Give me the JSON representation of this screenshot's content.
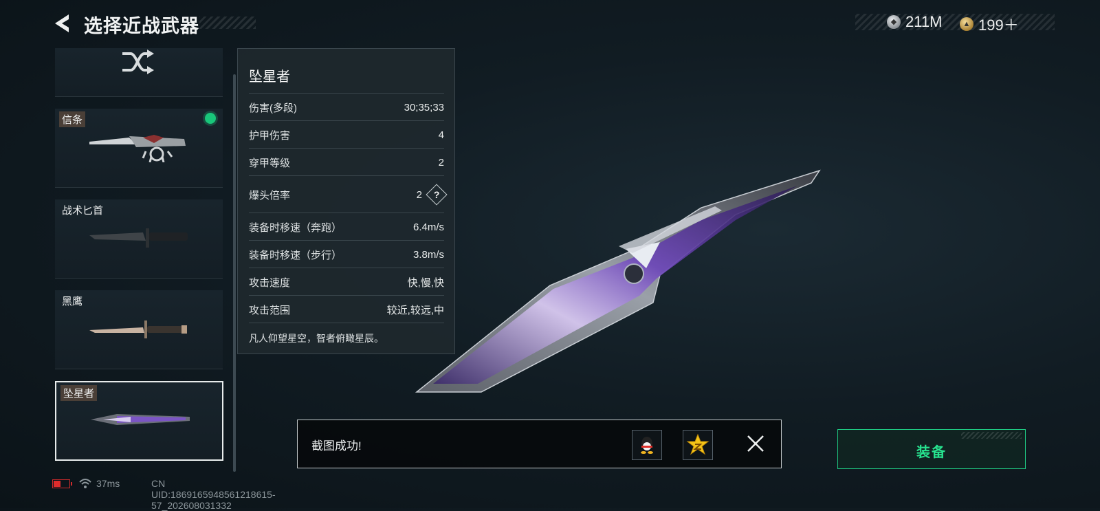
{
  "header": {
    "title": "选择近战武器"
  },
  "currency": [
    {
      "name": "silver-coin-icon",
      "value": "211M"
    },
    {
      "name": "gold-coin-icon",
      "value": "199＋"
    }
  ],
  "weapons": [
    {
      "name": "信条",
      "equipped": true
    },
    {
      "name": "战术匕首",
      "equipped": false
    },
    {
      "name": "黑鹰",
      "equipped": false
    },
    {
      "name": "坠星者",
      "equipped": false,
      "selected": true
    }
  ],
  "stats": {
    "title": "坠星者",
    "rows": [
      {
        "label": "伤害(多段)",
        "value": "30;35;33"
      },
      {
        "label": "护甲伤害",
        "value": "4"
      },
      {
        "label": "穿甲等级",
        "value": "2"
      },
      {
        "label": "爆头倍率",
        "value": "2"
      },
      {
        "label": "装备时移速（奔跑）",
        "value": "6.4m/s"
      },
      {
        "label": "装备时移速（步行）",
        "value": "3.8m/s"
      },
      {
        "label": "攻击速度",
        "value": "快,慢,快"
      },
      {
        "label": "攻击范围",
        "value": "较近,较远,中"
      }
    ],
    "help_symbol": "?",
    "description": "凡人仰望星空，智者俯瞰星辰。"
  },
  "toast": {
    "text": "截图成功!"
  },
  "equip_button": {
    "label": "装备"
  },
  "footer": {
    "ping": "37ms",
    "uid": "CN UID:1869165948561218615­57_202608031332"
  }
}
